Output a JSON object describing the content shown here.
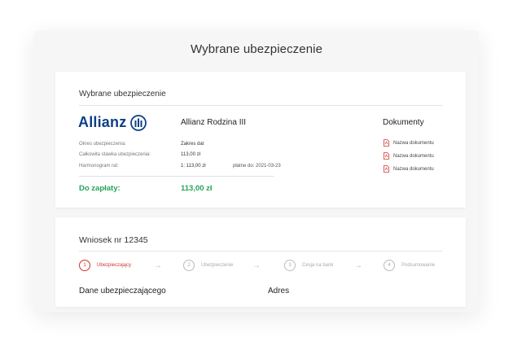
{
  "page": {
    "title": "Wybrane ubezpieczenie"
  },
  "insurance": {
    "section_title": "Wybrane ubezpieczenie",
    "logo_text": "Allianz",
    "product_name": "Allianz Rodzina III",
    "details": [
      {
        "label": "Okres ubezpieczenia:",
        "value": "Zakres dat"
      },
      {
        "label": "Całkowita stawka ubezpieczenia:",
        "value": "113,00 zł"
      },
      {
        "label": "Harmonogram rat:",
        "value": "1: 113,00 zł"
      }
    ],
    "due_text": "płatne do: 2021-03-23",
    "to_pay_label": "Do zapłaty:",
    "to_pay_value": "113,00 zł",
    "documents_title": "Dokumenty",
    "documents": [
      {
        "name": "Nazwa dokumentu",
        "icon": "pdf-icon"
      },
      {
        "name": "Nazwa dokumentu",
        "icon": "pdf-icon"
      },
      {
        "name": "Nazwa dokumentu",
        "icon": "pdf-icon"
      }
    ]
  },
  "application": {
    "title": "Wniosek nr 12345",
    "steps": [
      {
        "number": "1",
        "label": "Ubezpieczający",
        "active": true
      },
      {
        "number": "2",
        "label": "Ubezpieczenie",
        "active": false
      },
      {
        "number": "3",
        "label": "Cesja na bank",
        "active": false
      },
      {
        "number": "4",
        "label": "Podsumowanie",
        "active": false
      }
    ],
    "arrow_icon": "arrow-right-icon",
    "subsection_left": "Dane ubezpieczającego",
    "subsection_right": "Adres"
  },
  "colors": {
    "brand": "#0e3f86",
    "accent_green": "#27a35a",
    "active_step": "#d0342c"
  }
}
